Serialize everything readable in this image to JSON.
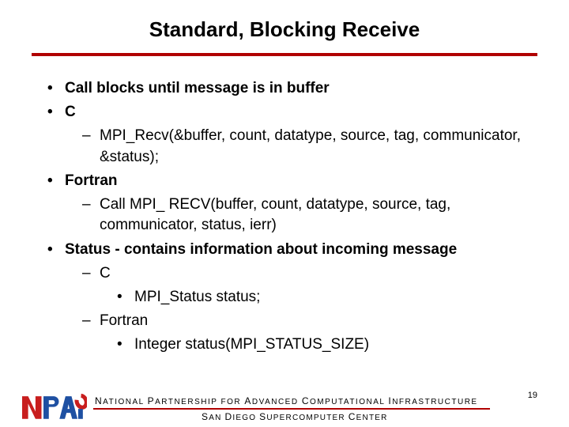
{
  "title": "Standard, Blocking Receive",
  "bullets": {
    "b1": "Call blocks until message is in buffer",
    "b2": "C",
    "b2_1": "MPI_Recv(&buffer, count, datatype, source, tag, communicator, &status);",
    "b3": "Fortran",
    "b3_1": "Call MPI_ RECV(buffer, count, datatype, source, tag, communicator, status, ierr)",
    "b4": "Status - contains information about incoming message",
    "b4_1": "C",
    "b4_1_1": "MPI_Status status;",
    "b4_2": "Fortran",
    "b4_2_1": "Integer status(MPI_STATUS_SIZE)"
  },
  "footer": {
    "line1_parts": [
      "N",
      "ATIONAL ",
      "P",
      "ARTNERSHIP FOR ",
      "A",
      "DVANCED ",
      "C",
      "OMPUTATIONAL ",
      "I",
      "NFRASTRUCTURE"
    ],
    "line2_parts": [
      "S",
      "AN ",
      "D",
      "IEGO ",
      "S",
      "UPERCOMPUTER ",
      "C",
      "ENTER"
    ]
  },
  "page_number": "19",
  "logo": {
    "text": "NPACI"
  }
}
